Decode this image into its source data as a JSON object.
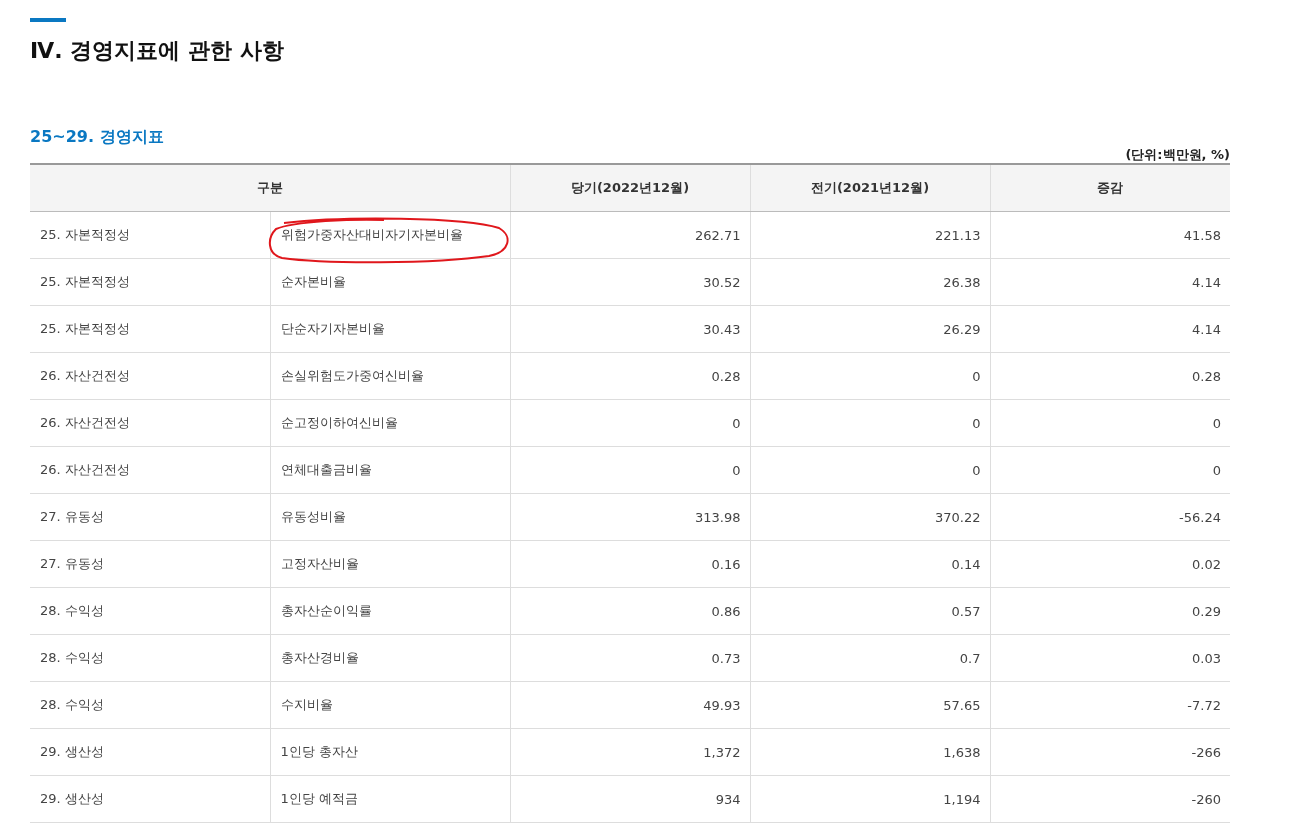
{
  "page_title": "Ⅳ. 경영지표에 관한 사항",
  "section": {
    "title": "25~29. 경영지표",
    "unit": "(단위:백만원, %)"
  },
  "table": {
    "columns": [
      "구분",
      "당기(2022년12월)",
      "전기(2021년12월)",
      "증감"
    ],
    "rows": [
      {
        "category": "25. 자본적정성",
        "item": "위험가중자산대비자기자본비율",
        "current": "262.71",
        "previous": "221.13",
        "change": "41.58",
        "circled": true
      },
      {
        "category": "25. 자본적정성",
        "item": "순자본비율",
        "current": "30.52",
        "previous": "26.38",
        "change": "4.14",
        "circled": false
      },
      {
        "category": "25. 자본적정성",
        "item": "단순자기자본비율",
        "current": "30.43",
        "previous": "26.29",
        "change": "4.14",
        "circled": false
      },
      {
        "category": "26. 자산건전성",
        "item": "손실위험도가중여신비율",
        "current": "0.28",
        "previous": "0",
        "change": "0.28",
        "circled": false
      },
      {
        "category": "26. 자산건전성",
        "item": "순고정이하여신비율",
        "current": "0",
        "previous": "0",
        "change": "0",
        "circled": false
      },
      {
        "category": "26. 자산건전성",
        "item": "연체대출금비율",
        "current": "0",
        "previous": "0",
        "change": "0",
        "circled": false
      },
      {
        "category": "27. 유동성",
        "item": "유동성비율",
        "current": "313.98",
        "previous": "370.22",
        "change": "-56.24",
        "circled": false
      },
      {
        "category": "27. 유동성",
        "item": "고정자산비율",
        "current": "0.16",
        "previous": "0.14",
        "change": "0.02",
        "circled": false
      },
      {
        "category": "28. 수익성",
        "item": "총자산순이익률",
        "current": "0.86",
        "previous": "0.57",
        "change": "0.29",
        "circled": false
      },
      {
        "category": "28. 수익성",
        "item": "총자산경비율",
        "current": "0.73",
        "previous": "0.7",
        "change": "0.03",
        "circled": false
      },
      {
        "category": "28. 수익성",
        "item": "수지비율",
        "current": "49.93",
        "previous": "57.65",
        "change": "-7.72",
        "circled": false
      },
      {
        "category": "29. 생산성",
        "item": "1인당 총자산",
        "current": "1,372",
        "previous": "1,638",
        "change": "-266",
        "circled": false
      },
      {
        "category": "29. 생산성",
        "item": "1인당 예적금",
        "current": "934",
        "previous": "1,194",
        "change": "-260",
        "circled": false
      }
    ]
  }
}
